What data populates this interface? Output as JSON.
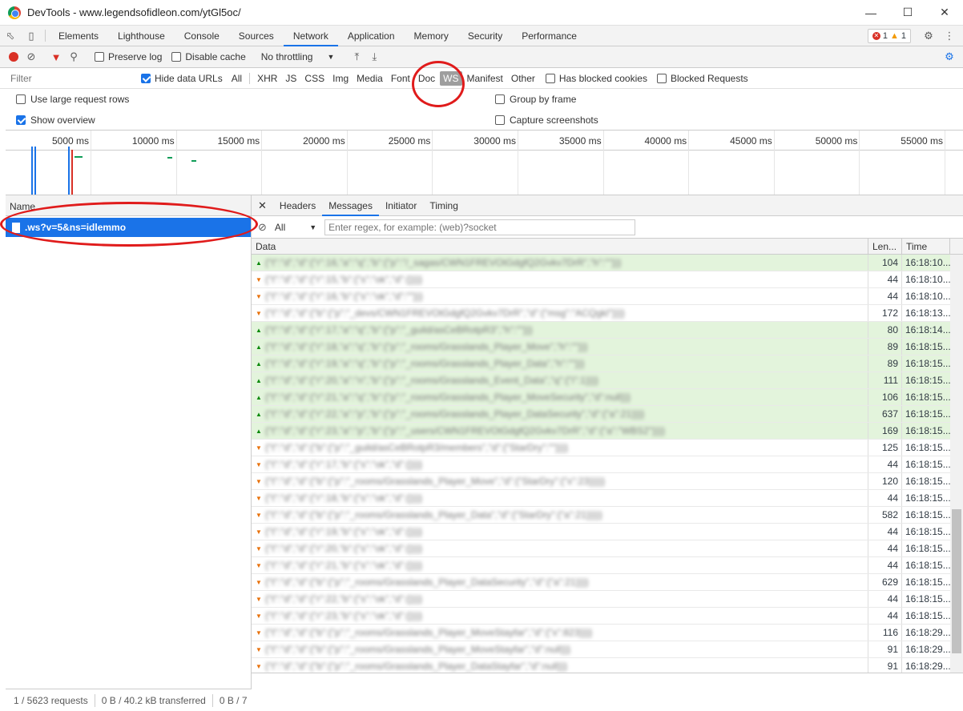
{
  "window": {
    "title": "DevTools - www.legendsofidleon.com/ytGl5oc/"
  },
  "tabs": [
    "Elements",
    "Lighthouse",
    "Console",
    "Sources",
    "Network",
    "Application",
    "Memory",
    "Security",
    "Performance"
  ],
  "active_tab": "Network",
  "badges": {
    "errors": "1",
    "warnings": "1"
  },
  "toolbar": {
    "preserve_log": "Preserve log",
    "disable_cache": "Disable cache",
    "throttling": "No throttling"
  },
  "filter": {
    "placeholder": "Filter",
    "hide_data_urls": "Hide data URLs",
    "types": [
      "All",
      "XHR",
      "JS",
      "CSS",
      "Img",
      "Media",
      "Font",
      "Doc",
      "WS",
      "Manifest",
      "Other"
    ],
    "selected_type": "WS",
    "has_blocked_cookies": "Has blocked cookies",
    "blocked_requests": "Blocked Requests"
  },
  "options": {
    "large_rows": "Use large request rows",
    "show_overview": "Show overview",
    "group_by_frame": "Group by frame",
    "capture_screenshots": "Capture screenshots"
  },
  "overview": {
    "ticks": [
      "5000 ms",
      "10000 ms",
      "15000 ms",
      "20000 ms",
      "25000 ms",
      "30000 ms",
      "35000 ms",
      "40000 ms",
      "45000 ms",
      "50000 ms",
      "55000 ms"
    ]
  },
  "requests": {
    "column": "Name",
    "items": [
      ".ws?v=5&ns=idlemmo"
    ]
  },
  "status": {
    "requests": "1 / 5623 requests",
    "transferred": "0 B / 40.2 kB transferred",
    "resources": "0 B / 7"
  },
  "detail": {
    "tabs": [
      "Headers",
      "Messages",
      "Initiator",
      "Timing"
    ],
    "active": "Messages",
    "filter_option": "All",
    "regex_placeholder": "Enter regex, for example: (web)?socket",
    "columns": {
      "data": "Data",
      "length": "Len...",
      "time": "Time"
    },
    "messages": [
      {
        "dir": "sent",
        "data": "{\"t\":\"d\",\"d\":{\"r\":16,\"a\":\"q\",\"b\":{\"p\":\"/_sagas/CWN1FREVOtGdgfQ2Gvkv7DrR\",\"h\":\"\"}}}",
        "len": "104",
        "time": "16:18:10..."
      },
      {
        "dir": "recv",
        "data": "{\"t\":\"d\",\"d\":{\"r\":15,\"b\":{\"s\":\"ok\",\"d\":{}}}}",
        "len": "44",
        "time": "16:18:10..."
      },
      {
        "dir": "recv",
        "data": "{\"t\":\"d\",\"d\":{\"r\":16,\"b\":{\"s\":\"ok\",\"d\":\"\"}}}",
        "len": "44",
        "time": "16:18:10..."
      },
      {
        "dir": "recv",
        "data": "{\"t\":\"d\",\"d\":{\"b\":{\"p\":\"_devs/CWN1FREVOtGdgfQ2Gvkv7DrR\",\"d\":{\"msg\":\"ACQgkl\"}}}}",
        "len": "172",
        "time": "16:18:13..."
      },
      {
        "dir": "sent",
        "data": "{\"t\":\"d\",\"d\":{\"r\":17,\"a\":\"q\",\"b\":{\"p\":\"_guild/asCeBRotpR3\",\"h\":\"\"}}}",
        "len": "80",
        "time": "16:18:14..."
      },
      {
        "dir": "sent",
        "data": "{\"t\":\"d\",\"d\":{\"r\":18,\"a\":\"q\",\"b\":{\"p\":\"_rooms/Grasslands_Player_Move\",\"h\":\"\"}}}",
        "len": "89",
        "time": "16:18:15..."
      },
      {
        "dir": "sent",
        "data": "{\"t\":\"d\",\"d\":{\"r\":19,\"a\":\"q\",\"b\":{\"p\":\"_rooms/Grasslands_Player_Data\",\"h\":\"\"}}}",
        "len": "89",
        "time": "16:18:15..."
      },
      {
        "dir": "sent",
        "data": "{\"t\":\"d\",\"d\":{\"r\":20,\"a\":\"n\",\"b\":{\"p\":\"_rooms/Grasslands_Event_Data\",\"q\":{\"i\":1}}}}",
        "len": "111",
        "time": "16:18:15..."
      },
      {
        "dir": "sent",
        "data": "{\"t\":\"d\",\"d\":{\"r\":21,\"a\":\"q\",\"b\":{\"p\":\"_rooms/Grasslands_Player_MoveSecurity\",\"d\":null}}}",
        "len": "106",
        "time": "16:18:15..."
      },
      {
        "dir": "sent",
        "data": "{\"t\":\"d\",\"d\":{\"r\":22,\"a\":\"p\",\"b\":{\"p\":\"_rooms/Grasslands_Player_DataSecurity\",\"d\":{\"a\":21}}}}",
        "len": "637",
        "time": "16:18:15..."
      },
      {
        "dir": "sent",
        "data": "{\"t\":\"d\",\"d\":{\"r\":23,\"a\":\"p\",\"b\":{\"p\":\"_users/CWN1FREVOtGdgfQ2Gvkv7DrR\",\"d\":{\"a\":\"WBS2\"}}}}",
        "len": "169",
        "time": "16:18:15..."
      },
      {
        "dir": "recv",
        "data": "{\"t\":\"d\",\"d\":{\"b\":{\"p\":\"_guild/asCeBRotpR3/members\",\"d\":{\"StarDry\":\"\"}}}}",
        "len": "125",
        "time": "16:18:15..."
      },
      {
        "dir": "recv",
        "data": "{\"t\":\"d\",\"d\":{\"r\":17,\"b\":{\"s\":\"ok\",\"d\":{}}}}",
        "len": "44",
        "time": "16:18:15..."
      },
      {
        "dir": "recv",
        "data": "{\"t\":\"d\",\"d\":{\"b\":{\"p\":\"_rooms/Grasslands_Player_Move\",\"d\":{\"StarDry\":{\"x\":23}}}}}",
        "len": "120",
        "time": "16:18:15..."
      },
      {
        "dir": "recv",
        "data": "{\"t\":\"d\",\"d\":{\"r\":18,\"b\":{\"s\":\"ok\",\"d\":{}}}}",
        "len": "44",
        "time": "16:18:15..."
      },
      {
        "dir": "recv",
        "data": "{\"t\":\"d\",\"d\":{\"b\":{\"p\":\"_rooms/Grasslands_Player_Data\",\"d\":{\"StarDry\":{\"a\":21}}}}}",
        "len": "582",
        "time": "16:18:15..."
      },
      {
        "dir": "recv",
        "data": "{\"t\":\"d\",\"d\":{\"r\":19,\"b\":{\"s\":\"ok\",\"d\":{}}}}",
        "len": "44",
        "time": "16:18:15..."
      },
      {
        "dir": "recv",
        "data": "{\"t\":\"d\",\"d\":{\"r\":20,\"b\":{\"s\":\"ok\",\"d\":{}}}}",
        "len": "44",
        "time": "16:18:15..."
      },
      {
        "dir": "recv",
        "data": "{\"t\":\"d\",\"d\":{\"r\":21,\"b\":{\"s\":\"ok\",\"d\":{}}}}",
        "len": "44",
        "time": "16:18:15..."
      },
      {
        "dir": "recv",
        "data": "{\"t\":\"d\",\"d\":{\"b\":{\"p\":\"_rooms/Grasslands_Player_DataSecurity\",\"d\":{\"a\":21}}}}",
        "len": "629",
        "time": "16:18:15..."
      },
      {
        "dir": "recv",
        "data": "{\"t\":\"d\",\"d\":{\"r\":22,\"b\":{\"s\":\"ok\",\"d\":{}}}}",
        "len": "44",
        "time": "16:18:15..."
      },
      {
        "dir": "recv",
        "data": "{\"t\":\"d\",\"d\":{\"r\":23,\"b\":{\"s\":\"ok\",\"d\":{}}}}",
        "len": "44",
        "time": "16:18:15..."
      },
      {
        "dir": "recv",
        "data": "{\"t\":\"d\",\"d\":{\"b\":{\"p\":\"_rooms/Grasslands_Player_MoveStayfar\",\"d\":{\"x\":823}}}}",
        "len": "116",
        "time": "16:18:29..."
      },
      {
        "dir": "recv",
        "data": "{\"t\":\"d\",\"d\":{\"b\":{\"p\":\"_rooms/Grasslands_Player_MoveStayfar\",\"d\":null}}}",
        "len": "91",
        "time": "16:18:29..."
      },
      {
        "dir": "recv",
        "data": "{\"t\":\"d\",\"d\":{\"b\":{\"p\":\"_rooms/Grasslands_Player_DataStayfar\",\"d\":null}}}",
        "len": "91",
        "time": "16:18:29..."
      }
    ]
  },
  "colors": {
    "accent": "#1a73e8",
    "sent_bg": "#e3f4dc",
    "annotation": "#e01b1b"
  }
}
